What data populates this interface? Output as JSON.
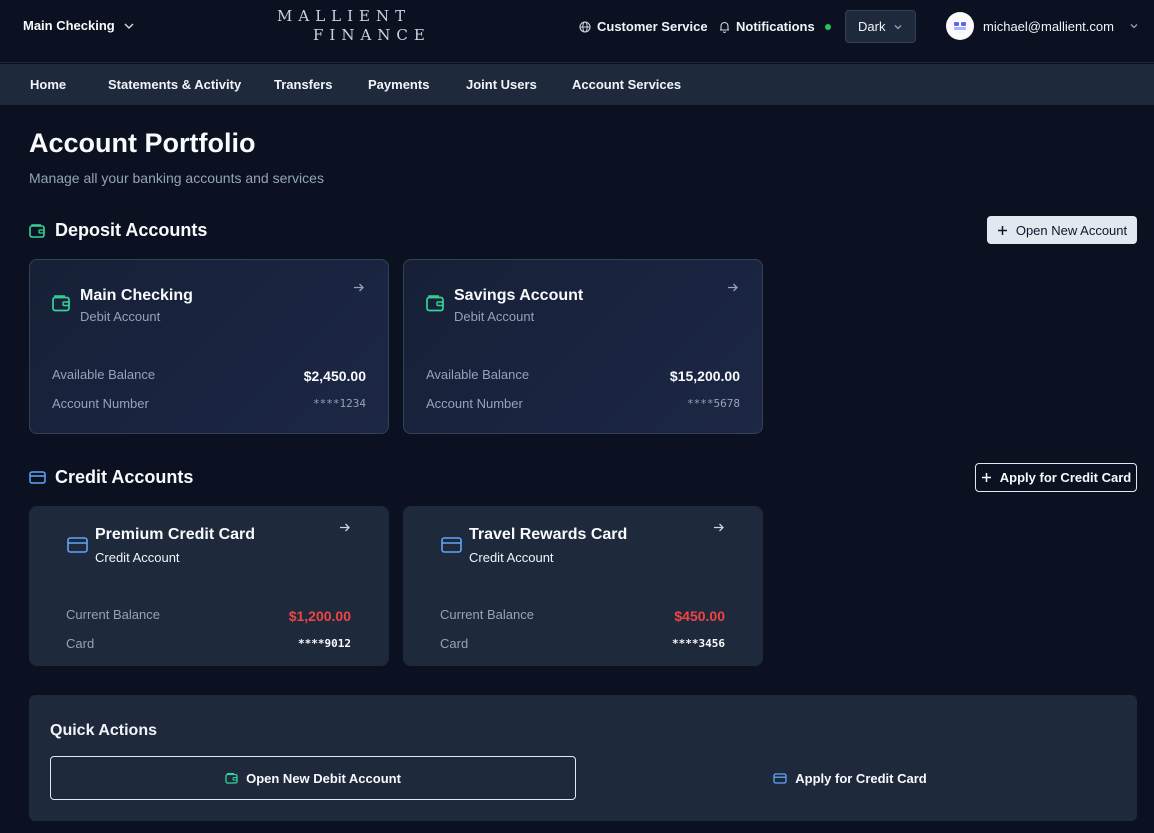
{
  "header": {
    "account_switcher": "Main Checking",
    "logo_line1": "MALLIENT",
    "logo_line2": "FINANCE",
    "customer_service": "Customer Service",
    "notifications": "Notifications",
    "theme": "Dark",
    "user_email": "michael@mallient.com",
    "colors": {
      "notification_dot": "#22c55e"
    }
  },
  "nav": {
    "items": [
      "Home",
      "Statements & Activity",
      "Transfers",
      "Payments",
      "Joint Users",
      "Account Services"
    ]
  },
  "page": {
    "title": "Account Portfolio",
    "subtitle": "Manage all your banking accounts and services"
  },
  "deposit": {
    "title": "Deposit Accounts",
    "action": "Open New Account",
    "accounts": [
      {
        "name": "Main Checking",
        "type": "Debit Account",
        "balance_label": "Available Balance",
        "balance": "$2,450.00",
        "number_label": "Account Number",
        "number": "****1234"
      },
      {
        "name": "Savings Account",
        "type": "Debit Account",
        "balance_label": "Available Balance",
        "balance": "$15,200.00",
        "number_label": "Account Number",
        "number": "****5678"
      }
    ]
  },
  "credit": {
    "title": "Credit Accounts",
    "action": "Apply for Credit Card",
    "accounts": [
      {
        "name": "Premium Credit Card",
        "type": "Credit Account",
        "balance_label": "Current Balance",
        "balance": "$1,200.00",
        "number_label": "Card",
        "number": "****9012"
      },
      {
        "name": "Travel Rewards Card",
        "type": "Credit Account",
        "balance_label": "Current Balance",
        "balance": "$450.00",
        "number_label": "Card",
        "number": "****3456"
      }
    ]
  },
  "quick_actions": {
    "title": "Quick Actions",
    "open_debit": "Open New Debit Account",
    "apply_credit": "Apply for Credit Card"
  },
  "colors": {
    "deposit_icon": "#34d399",
    "credit_icon": "#60a5fa",
    "credit_balance": "#ef4444"
  }
}
